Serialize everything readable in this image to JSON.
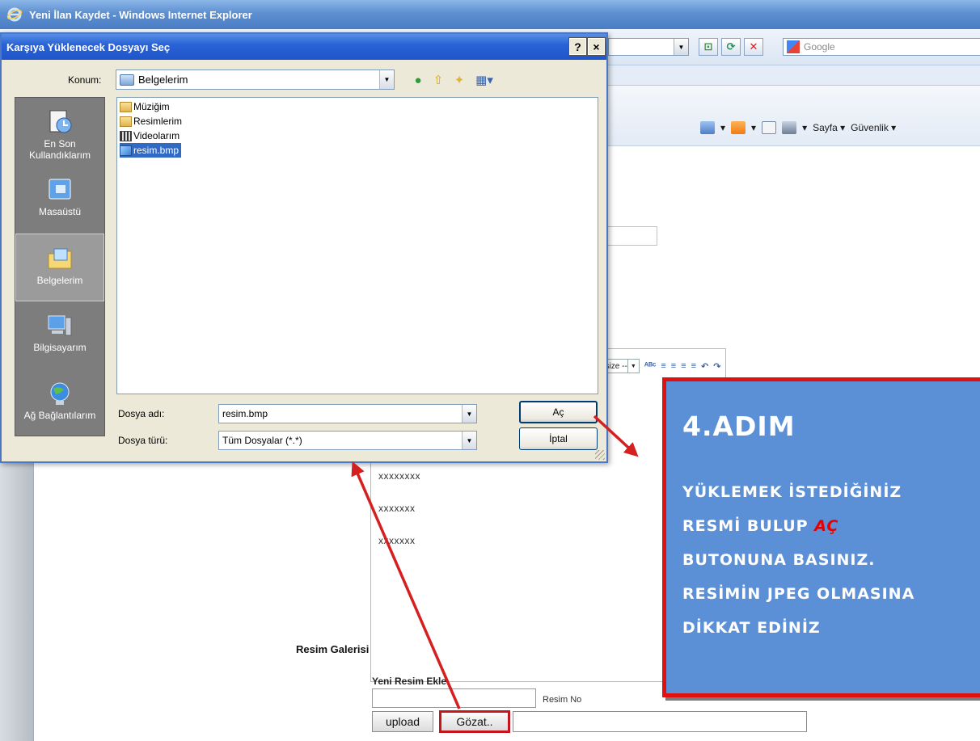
{
  "browser": {
    "title": "Yeni İlan Kaydet - Windows Internet Explorer",
    "search_placeholder": "Google",
    "command_bar": {
      "page_label": "Sayfa",
      "security_label": "Güvenlik"
    }
  },
  "dialog": {
    "title": "Karşıya Yüklenecek Dosyayı Seç",
    "help_label": "?",
    "close_label": "×",
    "location_label": "Konum:",
    "location_value": "Belgelerim",
    "places": [
      {
        "label": "En Son Kullandıklarım",
        "icon": "recent-documents-icon"
      },
      {
        "label": "Masaüstü",
        "icon": "desktop-icon"
      },
      {
        "label": "Belgelerim",
        "icon": "my-documents-icon",
        "selected": true
      },
      {
        "label": "Bilgisayarım",
        "icon": "my-computer-icon"
      },
      {
        "label": "Ağ Bağlantılarım",
        "icon": "network-icon"
      }
    ],
    "files": [
      {
        "name": "Müziğim",
        "icon": "music-folder-icon"
      },
      {
        "name": "Resimlerim",
        "icon": "folder-icon"
      },
      {
        "name": "Videolarım",
        "icon": "video-folder-icon"
      },
      {
        "name": "resim.bmp",
        "icon": "bitmap-file-icon",
        "selected": true
      }
    ],
    "filename_label": "Dosya adı:",
    "filename_value": "resim.bmp",
    "filetype_label": "Dosya türü:",
    "filetype_value": "Tüm Dosyalar (*.*)",
    "open_button": "Aç",
    "cancel_button": "İptal"
  },
  "editor": {
    "font_size_label": "t size --",
    "lines": [
      "xxxxxxxx",
      "xxxxxxx",
      "xxxxxxx"
    ]
  },
  "gallery": {
    "title": "Resim Galerisi",
    "new_image_label": "Yeni Resim Ekle",
    "image_no_label": "Resim No",
    "upload_button": "upload",
    "browse_button": "Gözat.."
  },
  "callout": {
    "title": "4.ADIM",
    "line1": "YÜKLEMEK İSTEDİĞİNİZ",
    "line2_prefix": "RESMİ BULUP ",
    "line2_highlight": "AÇ",
    "line3": "BUTONUNA BASINIZ.",
    "line4": "RESİMİN JPEG OLMASINA",
    "line5": "DİKKAT EDİNİZ"
  },
  "colors": {
    "callout_bg": "#5b8fd6",
    "callout_border": "#e01010",
    "arrow": "#d42020",
    "dialog_title": "#2a63d8"
  }
}
